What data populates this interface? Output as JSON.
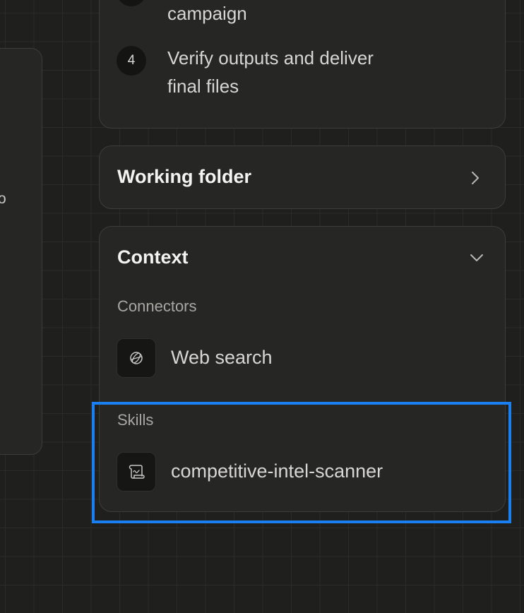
{
  "left_panel": {
    "clipped_text": "o"
  },
  "steps": [
    {
      "number": "",
      "lines": [
        "campaign"
      ]
    },
    {
      "number": "4",
      "lines": [
        "Verify outputs and deliver",
        "final files"
      ]
    }
  ],
  "working_folder": {
    "title": "Working folder",
    "icon": "chevron-right-icon"
  },
  "context": {
    "title": "Context",
    "icon": "chevron-down-icon",
    "connectors": {
      "label": "Connectors",
      "items": [
        {
          "label": "Web search",
          "icon": "globe-icon"
        }
      ]
    },
    "skills": {
      "label": "Skills",
      "items": [
        {
          "label": "competitive-intel-scanner",
          "icon": "scroll-icon"
        }
      ]
    }
  },
  "colors": {
    "highlight": "#1a7ff0",
    "background": "#1f1f1e",
    "card": "#262625"
  }
}
